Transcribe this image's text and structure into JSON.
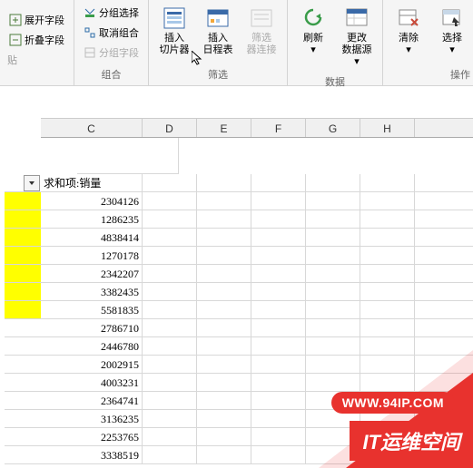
{
  "ribbon": {
    "group_field": {
      "expand": "展开字段",
      "collapse": "折叠字段"
    },
    "group_combine": {
      "label": "组合",
      "group_select": "分组选择",
      "ungroup": "取消组合",
      "group_fields": "分组字段"
    },
    "group_filter": {
      "label": "筛选",
      "insert_slicer_l1": "插入",
      "insert_slicer_l2": "切片器",
      "insert_timeline_l1": "插入",
      "insert_timeline_l2": "日程表",
      "filter_conn_l1": "筛选",
      "filter_conn_l2": "器连接"
    },
    "group_data": {
      "label": "数据",
      "refresh": "刷新",
      "change_src_l1": "更改",
      "change_src_l2": "数据源"
    },
    "group_actions": {
      "label": "操作",
      "clear": "清除",
      "select": "选择"
    }
  },
  "columns": [
    "C",
    "D",
    "E",
    "F",
    "G",
    "H"
  ],
  "pivot_header": "求和项:销量",
  "data_rows": [
    {
      "val": "2304126",
      "hl": true
    },
    {
      "val": "1286235",
      "hl": true
    },
    {
      "val": "4838414",
      "hl": true
    },
    {
      "val": "1270178",
      "hl": true
    },
    {
      "val": "2342207",
      "hl": true
    },
    {
      "val": "3382435",
      "hl": true
    },
    {
      "val": "5581835",
      "hl": true
    },
    {
      "val": "2786710",
      "hl": false
    },
    {
      "val": "2446780",
      "hl": false
    },
    {
      "val": "2002915",
      "hl": false
    },
    {
      "val": "4003231",
      "hl": false
    },
    {
      "val": "2364741",
      "hl": false
    },
    {
      "val": "3136235",
      "hl": false
    },
    {
      "val": "2253765",
      "hl": false
    },
    {
      "val": "3338519",
      "hl": false
    }
  ],
  "watermark": {
    "url": "WWW.94IP.COM",
    "brand": "IT运维空间"
  }
}
